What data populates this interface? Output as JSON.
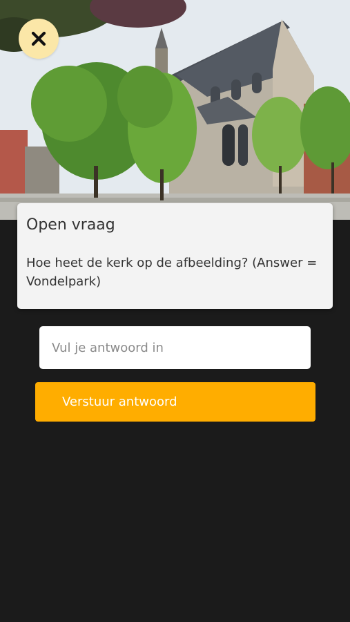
{
  "question": {
    "title": "Open vraag",
    "text": "Hoe heet de kerk op de afbeelding? (Answer = Vondelpark)"
  },
  "answer": {
    "placeholder": "Vul je antwoord in",
    "value": ""
  },
  "submit": {
    "label": "Verstuur antwoord"
  },
  "icons": {
    "close": "close-icon"
  },
  "colors": {
    "background": "#1b1b1b",
    "accent": "#ffad00",
    "close_button": "#fbe7a8",
    "card": "#f3f3f3"
  }
}
